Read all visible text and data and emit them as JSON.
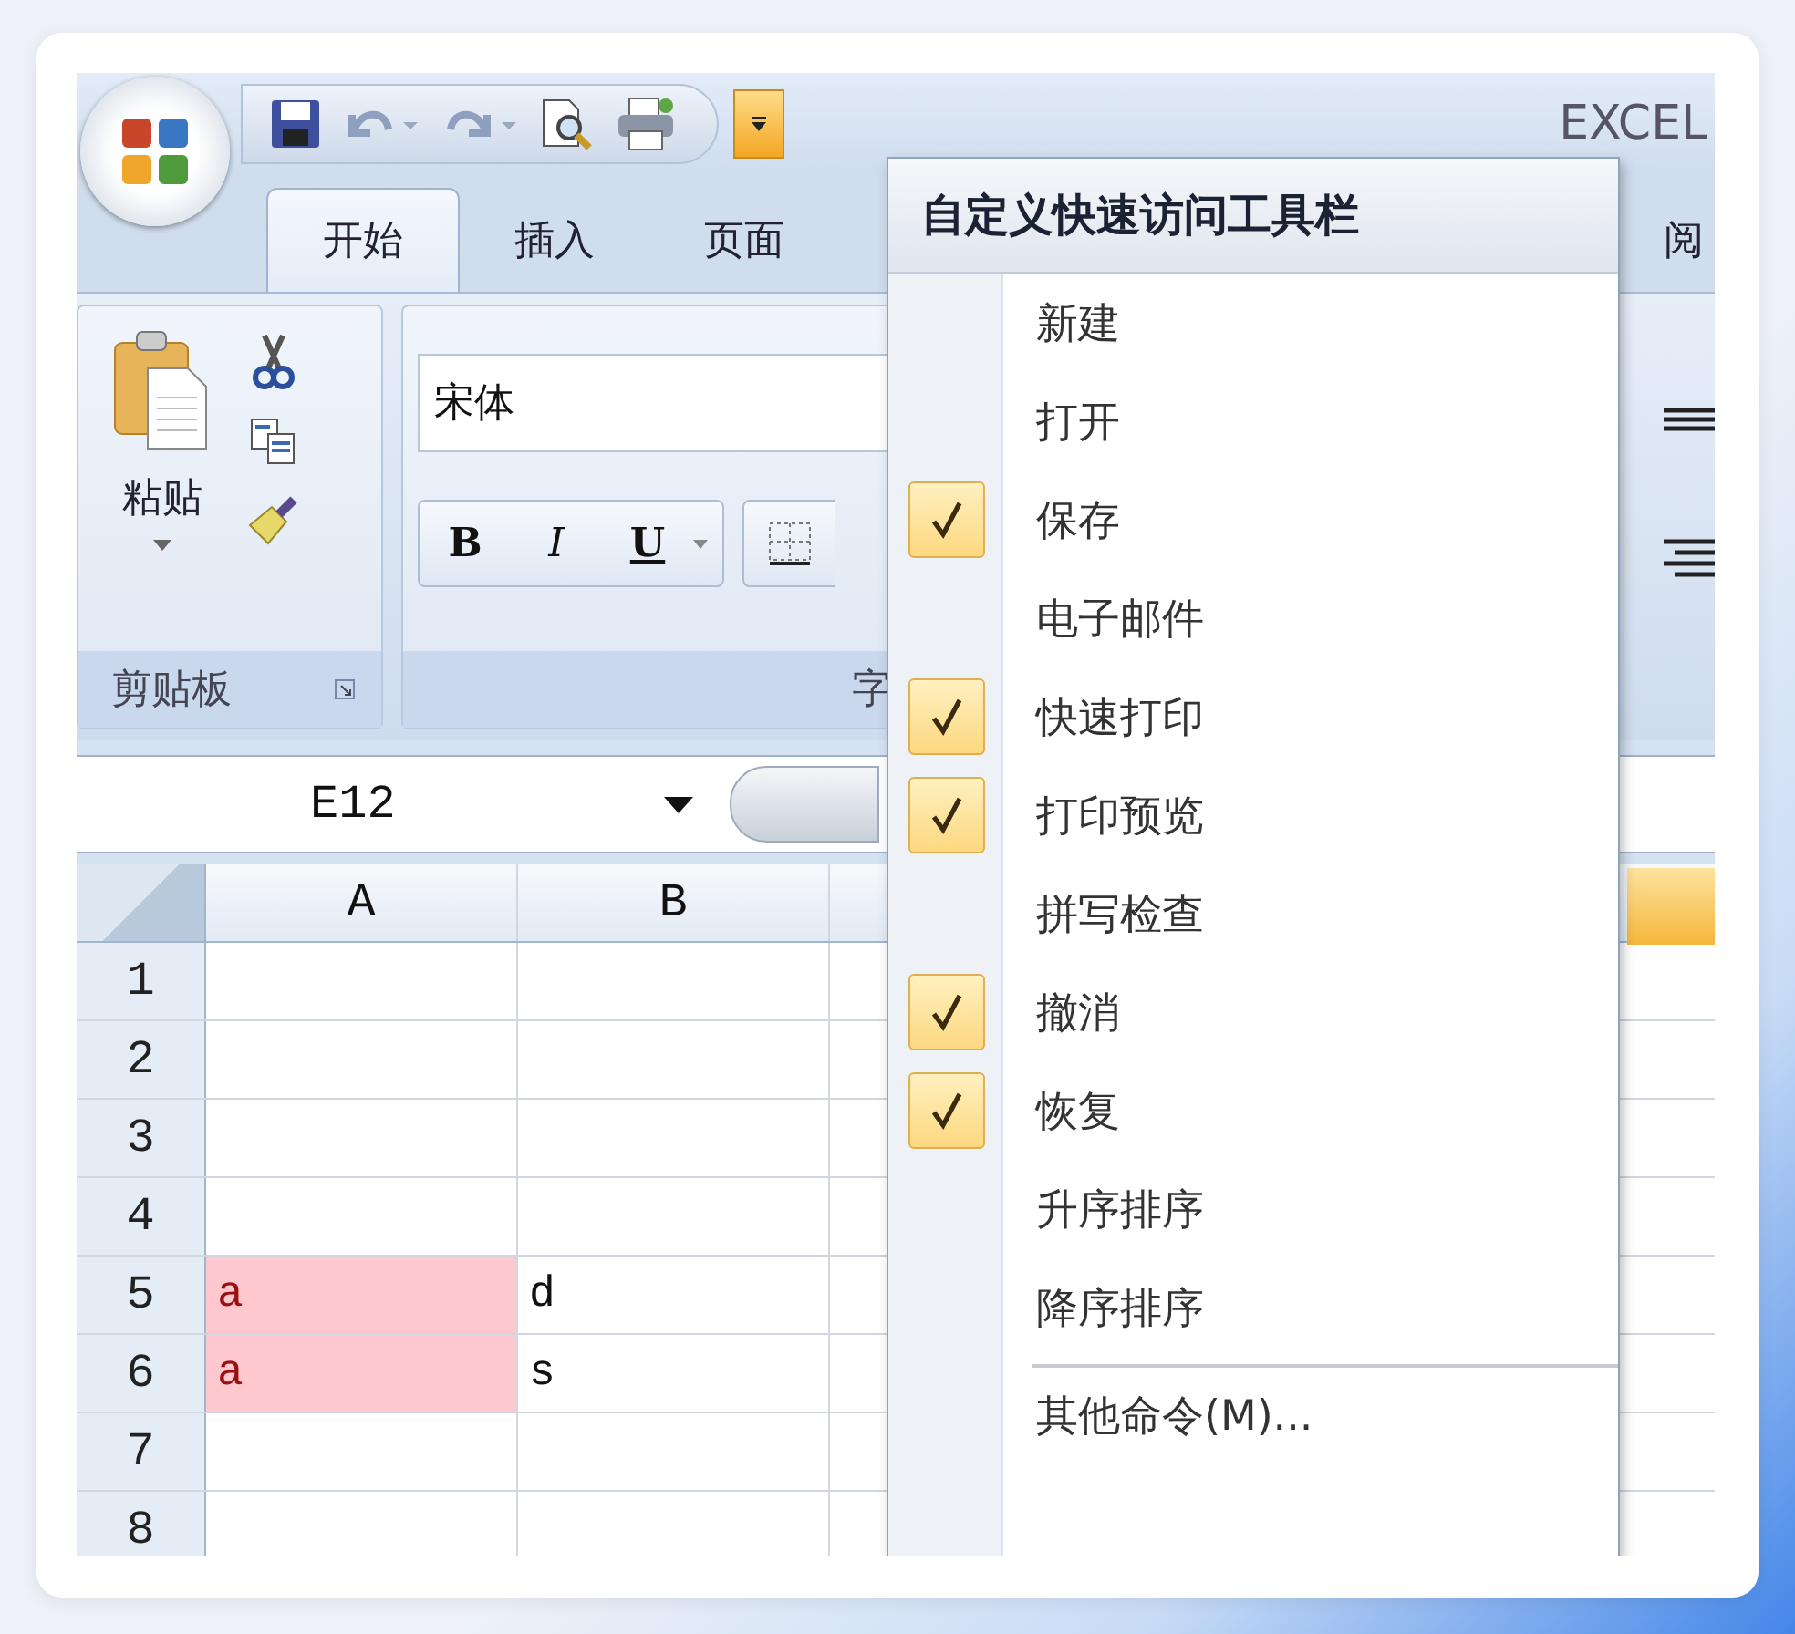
{
  "title_bar": {
    "title": "EXCEL"
  },
  "tabs": [
    {
      "label": "开始",
      "selected": true
    },
    {
      "label": "插入",
      "selected": false
    },
    {
      "label": "页面",
      "selected": false
    },
    {
      "label": "阅",
      "selected": false
    }
  ],
  "clipboard_group": {
    "paste_label": "粘贴",
    "label": "剪贴板"
  },
  "font_group": {
    "font_name": "宋体",
    "bold": "B",
    "italic": "I",
    "underline": "U",
    "label": "字"
  },
  "name_box": {
    "value": "E12"
  },
  "grid": {
    "columns": [
      "A",
      "B"
    ],
    "rows": [
      {
        "number": "1"
      },
      {
        "number": "2"
      },
      {
        "number": "3"
      },
      {
        "number": "4"
      },
      {
        "number": "5",
        "cells": [
          {
            "text": "a",
            "highlighted": true
          },
          {
            "text": "d",
            "highlighted": false
          }
        ]
      },
      {
        "number": "6",
        "cells": [
          {
            "text": "a",
            "highlighted": true
          },
          {
            "text": "s",
            "highlighted": false
          }
        ]
      },
      {
        "number": "7"
      },
      {
        "number": "8"
      }
    ]
  },
  "menu": {
    "title": "自定义快速访问工具栏",
    "items": [
      {
        "label": "新建",
        "checked": false
      },
      {
        "label": "打开",
        "checked": false
      },
      {
        "label": "保存",
        "checked": true
      },
      {
        "label": "电子邮件",
        "checked": false
      },
      {
        "label": "快速打印",
        "checked": true
      },
      {
        "label": "打印预览",
        "checked": true
      },
      {
        "label": "拼写检查",
        "checked": false
      },
      {
        "label": "撤消",
        "checked": true
      },
      {
        "label": "恢复",
        "checked": true
      },
      {
        "label": "升序排序",
        "checked": false
      },
      {
        "label": "降序排序",
        "checked": false
      }
    ],
    "more": "其他命令(M)..."
  }
}
